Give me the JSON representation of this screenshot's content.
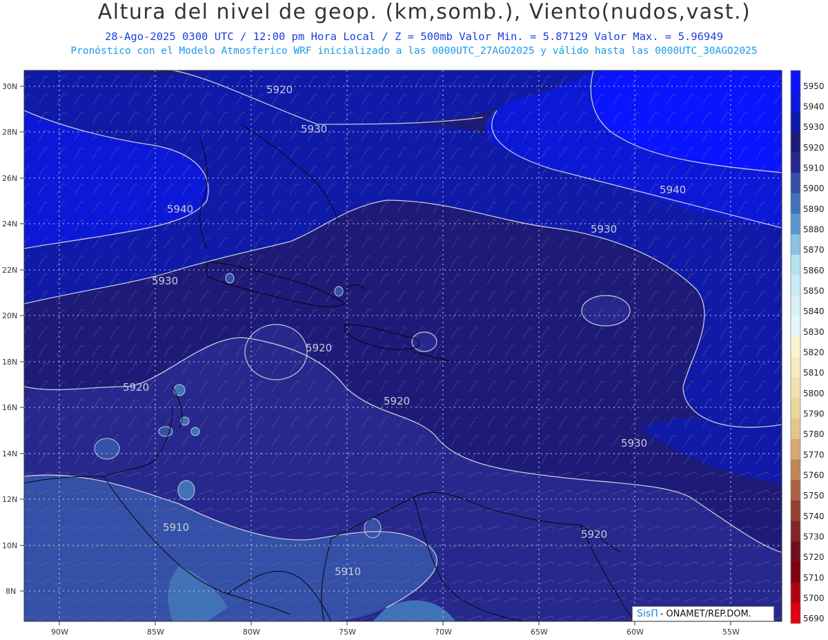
{
  "header": {
    "title": "Altura del nivel de geop. (km,somb.), Viento(nudos,vast.)",
    "subtitle1": "28-Ago-2025  0300 UTC / 12:00 pm Hora Local / Z = 500mb    Valor Min. = 5.87129  Valor Max. = 5.96949",
    "subtitle2": "Pronóstico con el Modelo Atmosferico WRF inicializado a las 0000UTC_27AGO2025 y válido hasta las  0000UTC_30AGO2025"
  },
  "map": {
    "lat_labels": [
      "30N",
      "28N",
      "26N",
      "24N",
      "22N",
      "20N",
      "18N",
      "16N",
      "14N",
      "12N",
      "10N",
      "8N"
    ],
    "lon_labels": [
      "90W",
      "85W",
      "80W",
      "75W",
      "70W",
      "65W",
      "60W",
      "55W"
    ],
    "contour_labels": [
      {
        "text": "5920"
      },
      {
        "text": "5930"
      },
      {
        "text": "5940"
      },
      {
        "text": "5930"
      },
      {
        "text": "5940"
      },
      {
        "text": "5930"
      },
      {
        "text": "5920"
      },
      {
        "text": "5920"
      },
      {
        "text": "5920"
      },
      {
        "text": "5930"
      },
      {
        "text": "5910"
      },
      {
        "text": "5920"
      },
      {
        "text": "5910"
      }
    ]
  },
  "colorbar": {
    "levels": [
      "5950",
      "5940",
      "5930",
      "5920",
      "5910",
      "5900",
      "5890",
      "5880",
      "5870",
      "5860",
      "5850",
      "5840",
      "5830",
      "5820",
      "5810",
      "5800",
      "5790",
      "5780",
      "5770",
      "5760",
      "5750",
      "5740",
      "5730",
      "5720",
      "5710",
      "5700",
      "5690"
    ],
    "colors": [
      "#0a14ff",
      "#0c18d8",
      "#101aa8",
      "#1e1a78",
      "#27288e",
      "#3450a8",
      "#4072b8",
      "#5c96cc",
      "#8cc0e0",
      "#b4e2f2",
      "#c8ecf6",
      "#d8f2f8",
      "#e6f6fa",
      "#fbf4d0",
      "#f6ecc0",
      "#f1e2ae",
      "#ecd89c",
      "#e4c68c",
      "#d4a870",
      "#c08658",
      "#aa6244",
      "#944034",
      "#802628",
      "#6e101c",
      "#7c0010",
      "#b00010",
      "#e00010"
    ]
  },
  "credit": {
    "brand": "SisΠ",
    "text": "- ONAMET/REP.DOM."
  }
}
